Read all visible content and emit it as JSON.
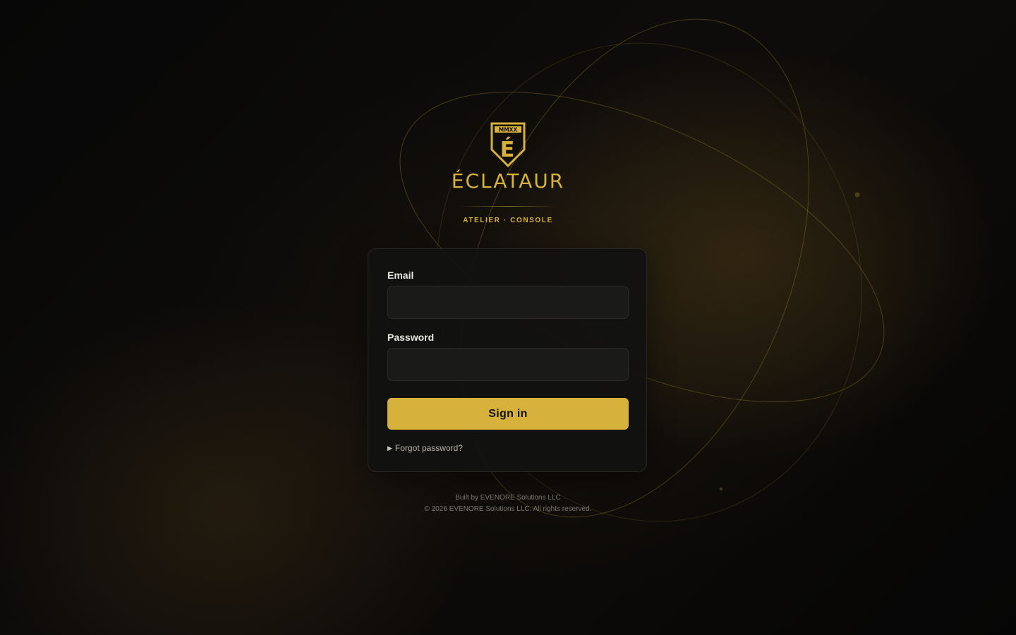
{
  "brand": {
    "crest_text": "MMXX",
    "crest_letter": "É",
    "wordmark": "ÉCLATAUR",
    "tagline": "ATELIER · CONSOLE"
  },
  "form": {
    "email_label": "Email",
    "email_value": "",
    "password_label": "Password",
    "password_value": "",
    "signin_label": "Sign in",
    "forgot_label": "Forgot password?",
    "forgot_icon": "triangle-right-icon"
  },
  "footer": {
    "built_by": "Built by EVENORE Solutions LLC",
    "copyright": "© 2026 EVENORE Solutions LLC. All rights reserved."
  },
  "colors": {
    "accent": "#d6b13c",
    "background": "#0a0908",
    "card": "#111110",
    "input": "#1a1a19"
  }
}
